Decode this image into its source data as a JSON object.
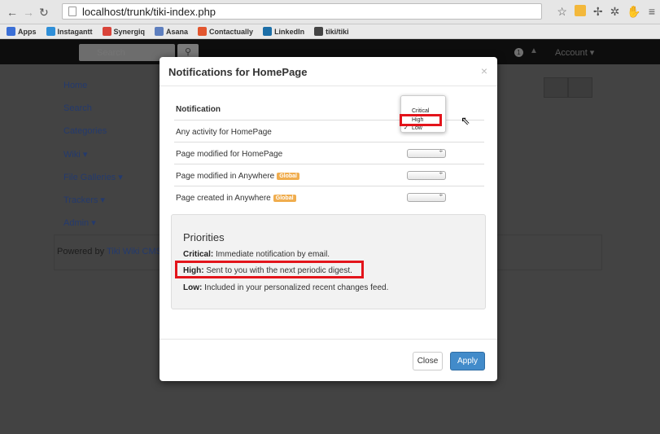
{
  "browser": {
    "url": "localhost/trunk/tiki-index.php",
    "bookmarks": [
      {
        "label": "Apps",
        "color": "#3b6fd6"
      },
      {
        "label": "Instagantt",
        "color": "#2f8fd8"
      },
      {
        "label": "Synergiq",
        "color": "#d9443a"
      },
      {
        "label": "Asana",
        "color": "#5e7fbf"
      },
      {
        "label": "Contactually",
        "color": "#e2562f"
      },
      {
        "label": "LinkedIn",
        "color": "#1c6fa8"
      },
      {
        "label": "tiki/tiki",
        "color": "#444444"
      }
    ]
  },
  "site": {
    "search_placeholder": "Search",
    "notif_count": "1",
    "account_label": "Account ▾",
    "sidebar": [
      "Home",
      "Search",
      "Categories",
      "Wiki ▾",
      "File Galleries ▾",
      "Trackers ▾",
      "Admin ▾"
    ],
    "powered_prefix": "Powered by ",
    "powered_link": "Tiki Wiki CMS G"
  },
  "modal": {
    "title": "Notifications for HomePage",
    "close_glyph": "×",
    "table_header": "Notification",
    "rows": [
      {
        "label": "Any activity for HomePage",
        "global": ""
      },
      {
        "label": "Page modified for HomePage",
        "global": ""
      },
      {
        "label": "Page modified in Anywhere",
        "global": "Global"
      },
      {
        "label": "Page created in Anywhere",
        "global": "Global"
      }
    ],
    "dropdown_options": [
      "Critical",
      "High",
      "Low"
    ],
    "dropdown_checked": "Low",
    "priorities": {
      "title": "Priorities",
      "critical_label": "Critical:",
      "critical_text": " Immediate notification by email.",
      "high_label": "High:",
      "high_text": " Sent to you with the next periodic digest.",
      "low_label": "Low:",
      "low_text": " Included in your personalized recent changes feed."
    },
    "close_button": "Close",
    "apply_button": "Apply"
  },
  "colors": {
    "apply": "#428bca",
    "highlight": "#e3141b",
    "global_tag": "#f0ad4e"
  }
}
